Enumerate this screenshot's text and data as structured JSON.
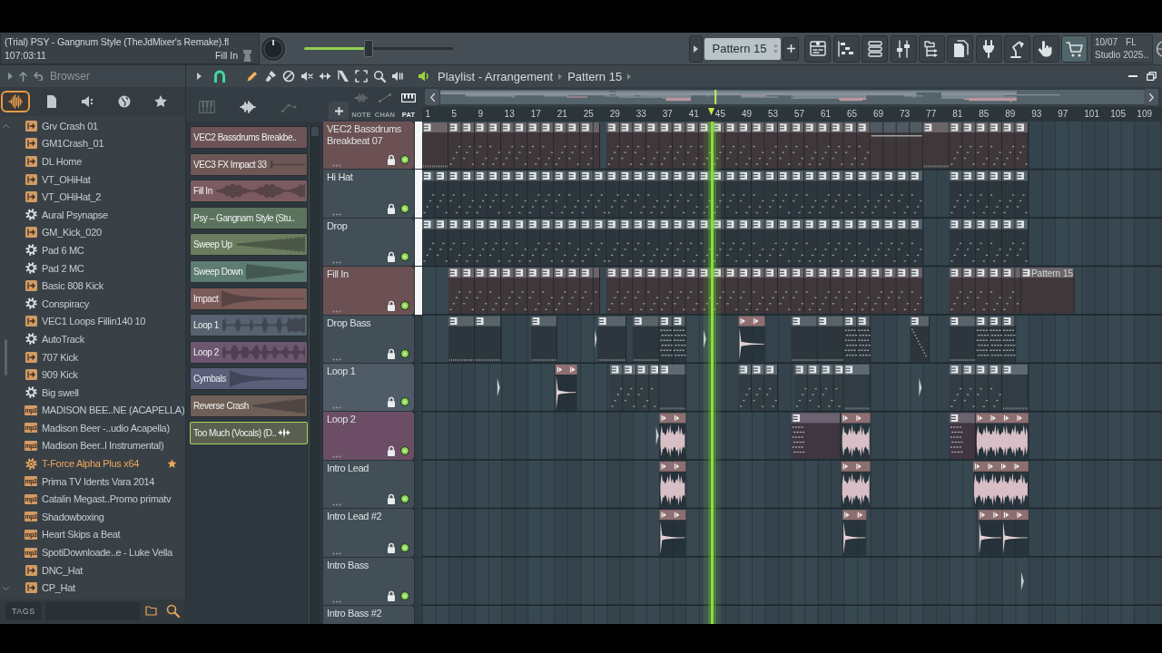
{
  "toolbar": {
    "song_title": "(Trial) PSY - Gangnum Style (TheJdMixer's Remake).fl",
    "song_time": "107:03:11",
    "hint": "Fill In",
    "master_volume": {
      "level": 0.43
    },
    "pattern": "Pattern 15",
    "date": "10/07",
    "version_lines": [
      "FL",
      "Studio 2025.."
    ]
  },
  "browser": {
    "title": "Browser",
    "tabs": [
      {
        "selected": true
      },
      {
        "selected": false
      },
      {
        "selected": false
      },
      {
        "selected": false
      },
      {
        "selected": false
      }
    ],
    "items": [
      {
        "label": "Grv Crash 01",
        "kind": "sample",
        "selected": false,
        "favorite": false
      },
      {
        "label": "GM1Crash_01",
        "kind": "sample",
        "selected": false,
        "favorite": false
      },
      {
        "label": "DL Home",
        "kind": "sample",
        "selected": false,
        "favorite": false
      },
      {
        "label": "VT_OHiHat",
        "kind": "sample",
        "selected": false,
        "favorite": false
      },
      {
        "label": "VT_OHiHat_2",
        "kind": "sample",
        "selected": false,
        "favorite": false
      },
      {
        "label": "Aural Psynapse",
        "kind": "preset",
        "selected": false,
        "favorite": false
      },
      {
        "label": "GM_Kick_020",
        "kind": "sample",
        "selected": false,
        "favorite": false
      },
      {
        "label": "Pad 6 MC",
        "kind": "preset",
        "selected": false,
        "favorite": false
      },
      {
        "label": "Pad 2 MC",
        "kind": "preset",
        "selected": false,
        "favorite": false
      },
      {
        "label": "Basic 808 Kick",
        "kind": "sample",
        "selected": false,
        "favorite": false
      },
      {
        "label": "Conspiracy",
        "kind": "preset",
        "selected": false,
        "favorite": false
      },
      {
        "label": "VEC1 Loops Fillin140 10",
        "kind": "sample",
        "selected": false,
        "favorite": false
      },
      {
        "label": "AutoTrack",
        "kind": "preset",
        "selected": false,
        "favorite": false
      },
      {
        "label": "707 Kick",
        "kind": "sample",
        "selected": false,
        "favorite": false
      },
      {
        "label": "909 Kick",
        "kind": "sample",
        "selected": false,
        "favorite": false
      },
      {
        "label": "Big swell",
        "kind": "preset",
        "selected": false,
        "favorite": false
      },
      {
        "label": "MADISON BEE..NE (ACAPELLA)",
        "kind": "audio-file",
        "badge": "mp3",
        "selected": false,
        "favorite": false
      },
      {
        "label": "Madison Beer -..udio Acapella)",
        "kind": "audio-file",
        "badge": "mp3",
        "selected": false,
        "favorite": false
      },
      {
        "label": "Madison Beer..l Instrumental)",
        "kind": "audio-file",
        "badge": "mp3",
        "selected": false,
        "favorite": false
      },
      {
        "label": "T-Force Alpha Plus x64",
        "kind": "plugin",
        "selected": true,
        "favorite": true
      },
      {
        "label": "Prima TV Idents Vara 2014",
        "kind": "audio-file",
        "badge": "mp3",
        "selected": false,
        "favorite": false
      },
      {
        "label": "Catalin Megast..Promo primatv",
        "kind": "audio-file",
        "badge": "mp3",
        "selected": false,
        "favorite": false
      },
      {
        "label": "Shadowboxing",
        "kind": "audio-file",
        "badge": "mp3",
        "selected": false,
        "favorite": false
      },
      {
        "label": "Heart Skips a Beat",
        "kind": "audio-file",
        "badge": "mp3",
        "selected": false,
        "favorite": false
      },
      {
        "label": "SpotiDownloade..e - Luke Vella",
        "kind": "audio-file",
        "badge": "mp3",
        "selected": false,
        "favorite": false
      },
      {
        "label": "DNC_Hat",
        "kind": "sample",
        "selected": false,
        "favorite": false
      },
      {
        "label": "CP_Hat",
        "kind": "sample",
        "selected": false,
        "favorite": false
      }
    ],
    "tags_label": "TAGS"
  },
  "playlist": {
    "title": "Playlist - Arrangement",
    "breadcrumb": "Pattern 15",
    "tools": [
      {
        "selected": true
      },
      {
        "selected": false
      },
      {
        "selected": false
      },
      {
        "selected": false
      },
      {
        "selected": false
      },
      {
        "selected": false
      },
      {
        "selected": false
      },
      {
        "selected": false
      },
      {
        "selected": false
      }
    ],
    "picker_tabs": [
      {
        "selected": false
      },
      {
        "selected": true
      },
      {
        "selected": false
      }
    ],
    "clips": [
      {
        "label": "VEC2 Bassdrums Breakbe..",
        "color": "#6c5457",
        "selected": false
      },
      {
        "label": "VEC3 FX Impact 33",
        "color": "#6d5856",
        "selected": false
      },
      {
        "label": "Fill In",
        "color": "#7b5b60",
        "selected": false
      },
      {
        "label": "Psy – Gangnam Style (Stu..",
        "color": "#5b735d",
        "selected": false
      },
      {
        "label": "Sweep Up",
        "color": "#6a7d5e",
        "selected": false
      },
      {
        "label": "Sweep Down",
        "color": "#5d7c72",
        "selected": false
      },
      {
        "label": "Impact",
        "color": "#7a5b58",
        "selected": false
      },
      {
        "label": "Loop 1",
        "color": "#56626f",
        "selected": false
      },
      {
        "label": "Loop 2",
        "color": "#6c5670",
        "selected": false
      },
      {
        "label": "Cymbals",
        "color": "#5a5f7a",
        "selected": false
      },
      {
        "label": "Reverse Crash",
        "color": "#6e6057",
        "selected": false
      },
      {
        "label": "Too Much (Vocals) (D..",
        "color": "#5a6050",
        "selected": true
      }
    ],
    "view_toggles": [
      {
        "label": "NOTE",
        "selected": false
      },
      {
        "label": "CHAN",
        "selected": false
      },
      {
        "label": "PAT",
        "selected": true
      }
    ],
    "ruler": [
      "1",
      "5",
      "9",
      "13",
      "17",
      "21",
      "25",
      "29",
      "33",
      "37",
      "41",
      "45",
      "49",
      "53",
      "57",
      "61",
      "65",
      "69",
      "73",
      "77",
      "81",
      "85",
      "89",
      "93",
      "97",
      "101",
      "105",
      "109"
    ],
    "tracks": [
      {
        "name": "VEC2 Bassdrums Breakbeat 07",
        "color": "#6b5153",
        "selected": true,
        "on": true
      },
      {
        "name": "Hi Hat",
        "color": "#434f57",
        "selected": true,
        "on": true
      },
      {
        "name": "Drop",
        "color": "#434f57",
        "selected": true,
        "on": true
      },
      {
        "name": "Fill In",
        "color": "#6b5153",
        "selected": true,
        "on": true
      },
      {
        "name": "Drop Bass",
        "color": "#434f57",
        "selected": false,
        "on": true
      },
      {
        "name": "Loop 1",
        "color": "#4f5c67",
        "selected": false,
        "on": true
      },
      {
        "name": "Loop 2",
        "color": "#6b4e65",
        "selected": false,
        "on": true
      },
      {
        "name": "Intro Lead",
        "color": "#434f57",
        "selected": false,
        "on": true
      },
      {
        "name": "Intro Lead #2",
        "color": "#434f57",
        "selected": false,
        "on": true
      },
      {
        "name": "Intro Bass",
        "color": "#434f57",
        "selected": false,
        "on": true
      },
      {
        "name": "Intro Bass #2",
        "color": "#434f57",
        "selected": false
      }
    ],
    "clip_label": "Pattern 15"
  }
}
